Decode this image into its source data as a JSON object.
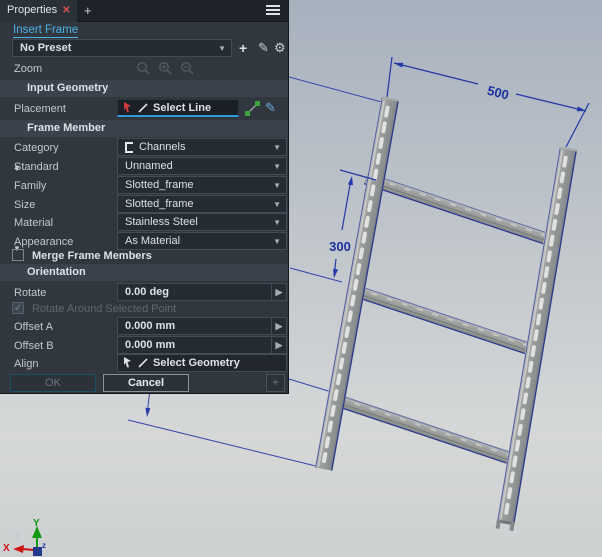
{
  "panel": {
    "tab": {
      "title": "Properties",
      "close_glyph": "✕",
      "add_tab": "+"
    },
    "command_link": "Insert Frame",
    "preset": {
      "value": "No Preset"
    },
    "zoom_label": "Zoom",
    "input_geometry": {
      "header": "Input Geometry",
      "placement_label": "Placement",
      "placement_value": "Select Line"
    },
    "frame_member": {
      "header": "Frame Member",
      "rows": [
        {
          "label": "Category",
          "value": "Channels"
        },
        {
          "label": "Standard",
          "value": "Unnamed"
        },
        {
          "label": "Family",
          "value": "Slotted_frame"
        },
        {
          "label": "Size",
          "value": "Slotted_frame"
        },
        {
          "label": "Material",
          "value": "Stainless Steel"
        },
        {
          "label": "Appearance",
          "value": "As Material"
        }
      ],
      "merge_label": "Merge Frame Members"
    },
    "orientation": {
      "header": "Orientation",
      "rotate_label": "Rotate",
      "rotate_value": "0.00 deg",
      "rotate_around_label": "Rotate Around Selected Point",
      "rotate_around_check": "✓",
      "offset_a_label": "Offset A",
      "offset_a_value": "0.000 mm",
      "offset_b_label": "Offset B",
      "offset_b_value": "0.000 mm",
      "align_label": "Align",
      "align_value": "Select Geometry"
    },
    "buttons": {
      "ok": "OK",
      "cancel": "Cancel",
      "add": "+"
    }
  },
  "viewport": {
    "dimensions": {
      "width": "500",
      "spacing": "300"
    },
    "axis": {
      "x": "X",
      "y": "Y",
      "z": "z"
    }
  },
  "colors": {
    "link_blue": "#4FB3E8",
    "highlight_blue": "#2D9CDB",
    "dimension_blue": "#2438A8",
    "steel_gray": "#9A9D9C",
    "panel_bg": "#31373E",
    "axis_x_red": "#CC1111",
    "axis_y_green": "#119911",
    "close_red": "#D9534F"
  }
}
